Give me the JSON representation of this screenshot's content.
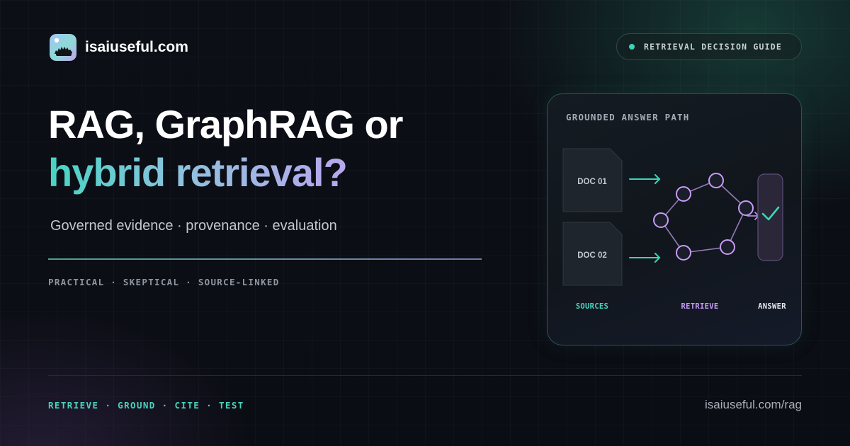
{
  "brand": {
    "name": "isaiuseful.com"
  },
  "badge": {
    "label": "RETRIEVAL DECISION GUIDE"
  },
  "hero": {
    "title_line1": "RAG, GraphRAG or",
    "title_line2": "hybrid retrieval?",
    "subtitle": "Governed evidence · provenance · evaluation",
    "values": "PRACTICAL · SKEPTICAL · SOURCE-LINKED"
  },
  "card": {
    "title": "GROUNDED ANSWER PATH",
    "docs": [
      "DOC 01",
      "DOC 02"
    ],
    "stages": {
      "sources": "SOURCES",
      "retrieve": "RETRIEVE",
      "answer": "ANSWER"
    }
  },
  "footer": {
    "tagline": "RETRIEVE · GROUND · CITE · TEST",
    "url": "isaiuseful.com/rag"
  },
  "colors": {
    "accent_teal": "#3ad6b6",
    "accent_purple": "#c79cf5",
    "background": "#0b0e15"
  },
  "icons": {
    "logo": "hedgehog-logo-icon",
    "check": "checkmark-icon"
  }
}
